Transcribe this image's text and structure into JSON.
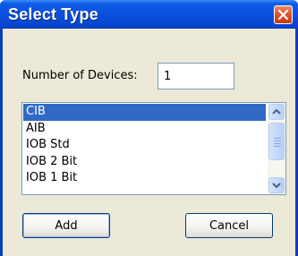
{
  "window": {
    "title": "Select Type"
  },
  "form": {
    "number_label": "Number of Devices:",
    "number_value": "1"
  },
  "list": {
    "items": [
      "CIB",
      "AIB",
      "IOB Std",
      "IOB 2 Bit",
      "IOB 1 Bit"
    ],
    "selected": "CIB"
  },
  "buttons": {
    "add": "Add",
    "cancel": "Cancel"
  },
  "colors": {
    "titlebar": "#0a4fdd",
    "selection": "#316ac5",
    "dialog_bg": "#ece9d8",
    "close_button": "#e2532c"
  },
  "icons": [
    "close-icon",
    "scroll-up-arrow-icon",
    "scroll-down-arrow-icon"
  ]
}
